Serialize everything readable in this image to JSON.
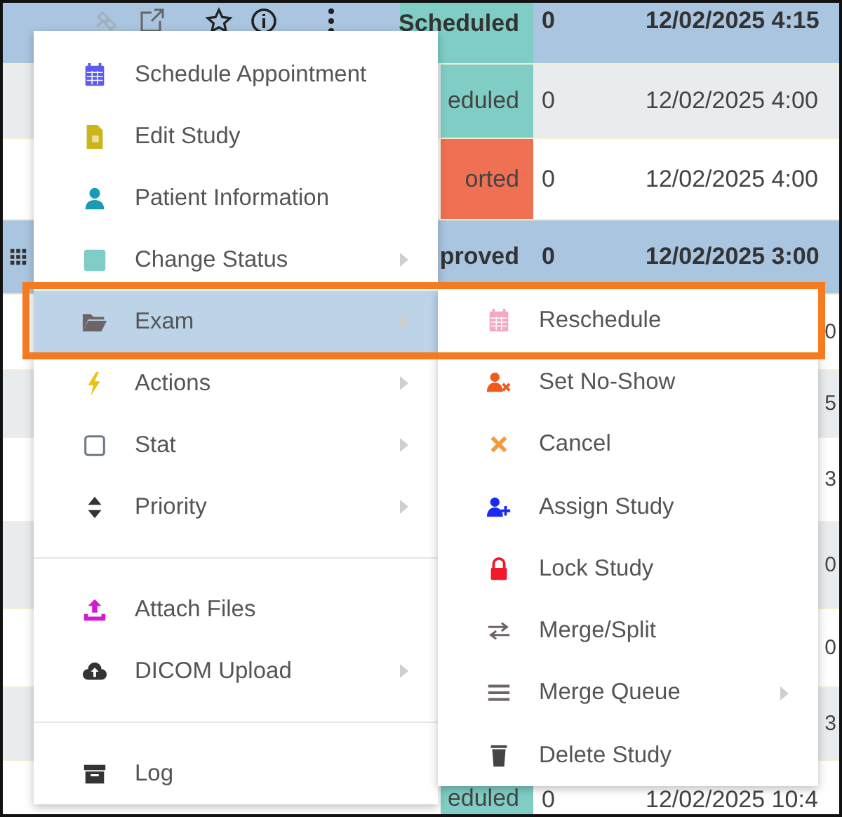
{
  "table": {
    "rows": [
      {
        "selected": true,
        "status": "Scheduled",
        "color": "#7fcdc5",
        "count": "0",
        "date": "12/02/2025 4:15"
      },
      {
        "selected": false,
        "status": "eduled",
        "color": "#7fcdc5",
        "count": "0",
        "date": "12/02/2025 4:00"
      },
      {
        "selected": false,
        "status": "orted",
        "color": "#ef7052",
        "count": "0",
        "date": "12/02/2025 4:00"
      },
      {
        "selected": true,
        "status": "proved",
        "count": "0",
        "date": "12/02/2025 3:00"
      },
      {
        "selected": false,
        "trailing": "0"
      },
      {
        "selected": false,
        "trailing": "5"
      },
      {
        "selected": false,
        "trailing": "3"
      },
      {
        "selected": false,
        "trailing": "0"
      },
      {
        "selected": false,
        "trailing": "0"
      },
      {
        "selected": false,
        "trailing": "3"
      },
      {
        "selected": false,
        "status": "eduled",
        "color": "#7fcdc5",
        "count": "0",
        "date": "12/02/2025 10:4"
      }
    ]
  },
  "context_menu": {
    "groups": [
      [
        {
          "label": "Schedule Appointment",
          "submenu": false,
          "selected": false
        },
        {
          "label": "Edit Study",
          "submenu": false,
          "selected": false
        },
        {
          "label": "Patient Information",
          "submenu": false,
          "selected": false
        },
        {
          "label": "Change Status",
          "submenu": true,
          "selected": false
        },
        {
          "label": "Exam",
          "submenu": true,
          "selected": true
        },
        {
          "label": "Actions",
          "submenu": true,
          "selected": false
        },
        {
          "label": "Stat",
          "submenu": true,
          "selected": false
        },
        {
          "label": "Priority",
          "submenu": true,
          "selected": false
        }
      ],
      [
        {
          "label": "Attach Files",
          "submenu": false,
          "selected": false
        },
        {
          "label": "DICOM Upload",
          "submenu": true,
          "selected": false
        }
      ],
      [
        {
          "label": "Log",
          "submenu": false,
          "selected": false
        }
      ]
    ]
  },
  "submenu": {
    "items": [
      {
        "label": "Reschedule",
        "submenu": false
      },
      {
        "label": "Set No-Show",
        "submenu": false
      },
      {
        "label": "Cancel",
        "submenu": false
      },
      {
        "label": "Assign Study",
        "submenu": false
      },
      {
        "label": "Lock Study",
        "submenu": false
      },
      {
        "label": "Merge/Split",
        "submenu": false
      },
      {
        "label": "Merge Queue",
        "submenu": true
      },
      {
        "label": "Delete Study",
        "submenu": false
      }
    ]
  }
}
